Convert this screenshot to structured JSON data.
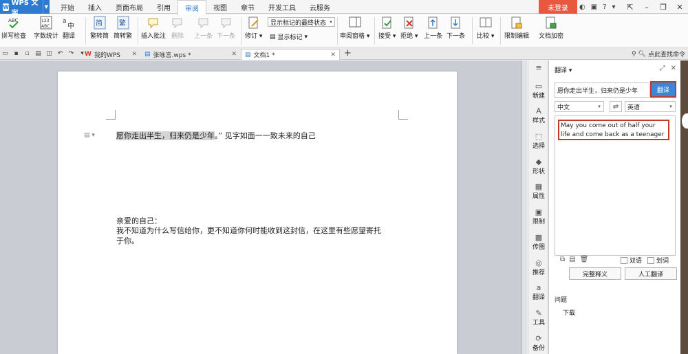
{
  "app": {
    "name": "WPS 文字",
    "logo": "W"
  },
  "menu": {
    "tabs": [
      "开始",
      "插入",
      "页面布局",
      "引用",
      "审阅",
      "视图",
      "章节",
      "开发工具",
      "云服务"
    ],
    "active_index": 4
  },
  "login": "未登录",
  "title_icons": [
    "skin-icon",
    "theme-icon",
    "help-icon",
    "dropdown-icon"
  ],
  "ribbon": {
    "spell_check": "拼写检查",
    "word_count": "字数统计",
    "translate": "翻译",
    "to_simplified": "繁转简",
    "to_traditional": "简转繁",
    "insert_comment": "插入批注",
    "delete": "删除",
    "prev": "上一条",
    "next": "下一条",
    "revise": "修订",
    "markup_select": "显示标记的最终状态",
    "show_markup": "显示标记",
    "review_pane": "审阅窗格",
    "accept": "接受",
    "reject": "拒绝",
    "prev2": "上一条",
    "next2": "下一条",
    "compare": "比较",
    "restrict_edit": "限制编辑",
    "encrypt": "文档加密"
  },
  "tabs": {
    "my_wps": "我的WPS",
    "doc1": "张咏言.wps *",
    "doc2": "文档1 *",
    "find_cmd": "点此查找命令"
  },
  "document": {
    "line1_highlight": "愿你走出半生，归来仍是少年",
    "line1_rest": "。”  见字如面一一致未来的自己",
    "line2": "亲爱的自己：",
    "line3": "我不知道为什么写信给你，更不知道你何时能收到这封信，在这里有些愿望寄托",
    "line4": "于你。"
  },
  "side": {
    "items": [
      "新建",
      "样式",
      "选择",
      "形状",
      "属性",
      "限制",
      "传图",
      "推荐",
      "翻译",
      "工具",
      "备份"
    ]
  },
  "panel": {
    "title": "翻译 ▾",
    "source_text": "愿你走出半生，归来仍是少年",
    "translate_button": "翻译",
    "from_lang": "中文",
    "to_lang": "英语",
    "result": "May you come out of half your life and come back as a teenager",
    "bilingual": "双语",
    "word_translate": "划词",
    "full_definition": "完整释义",
    "human_translate": "人工翻译",
    "faq": "问题",
    "faq_item": "下载"
  }
}
